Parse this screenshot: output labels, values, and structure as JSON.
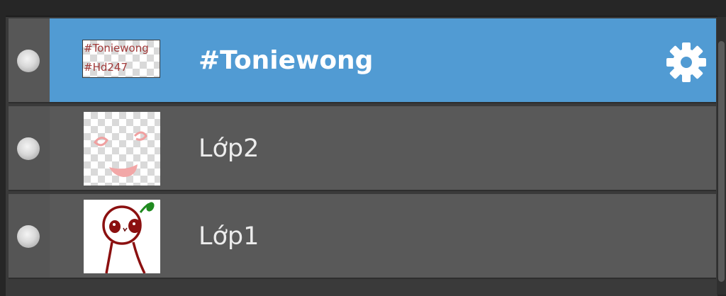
{
  "layers": [
    {
      "name": "#Toniewong",
      "selected": true,
      "thumbnail_lines": [
        "#Toniewong",
        "#Hd247"
      ],
      "thumbnail_text_color": "#a23b3b",
      "settings_icon": "gear-icon"
    },
    {
      "name": "Lớp2",
      "selected": false,
      "thumbnail": "transparent-with-pink-face-marks"
    },
    {
      "name": "Lớp1",
      "selected": false,
      "thumbnail": "white-with-dark-red-character"
    }
  ],
  "colors": {
    "selected_row": "#519bd3",
    "row": "#595959",
    "panel_background": "#262626"
  },
  "icons": {
    "visibility": "visibility-dot-icon",
    "settings": "gear-icon"
  }
}
